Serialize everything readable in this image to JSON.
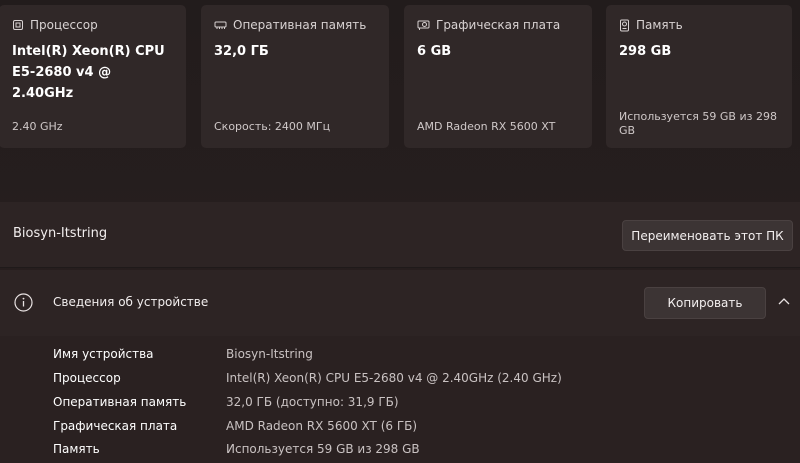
{
  "cards": [
    {
      "icon": "cpu-icon",
      "title": "Процессор",
      "value_lines": [
        "Intel(R) Xeon(R) CPU",
        "E5-2680 v4 @",
        "2.40GHz"
      ],
      "sub_lines": [
        "2.40 GHz"
      ]
    },
    {
      "icon": "memory-icon",
      "title": "Оперативная память",
      "value_lines": [
        "32,0 ГБ"
      ],
      "sub_lines": [
        "Скорость: 2400 МГц"
      ]
    },
    {
      "icon": "gpu-icon",
      "title": "Графическая плата",
      "value_lines": [
        "6 GB"
      ],
      "sub_lines": [
        "AMD Radeon RX 5600 XT"
      ]
    },
    {
      "icon": "storage-icon",
      "title": "Память",
      "value_lines": [
        "298 GB"
      ],
      "sub_lines": [
        "Используется 59 GB из 298",
        "GB"
      ]
    }
  ],
  "rename": {
    "pc_name": "Biosyn-Itstring",
    "button_label": "Переименовать этот ПК"
  },
  "device_specs": {
    "title": "Сведения об устройстве",
    "copy_label": "Копировать",
    "rows": [
      {
        "label": "Имя устройства",
        "value": "Biosyn-Itstring"
      },
      {
        "label": "Процессор",
        "value": "Intel(R) Xeon(R) CPU E5-2680 v4 @ 2.40GHz (2.40 GHz)"
      },
      {
        "label": "Оперативная память",
        "value": "32,0 ГБ (доступно: 31,9 ГБ)"
      },
      {
        "label": "Графическая плата",
        "value": "AMD Radeon RX 5600 XT (6 ГБ)"
      },
      {
        "label": "Память",
        "value": "Используется 59 GB из 298 GB"
      }
    ]
  }
}
